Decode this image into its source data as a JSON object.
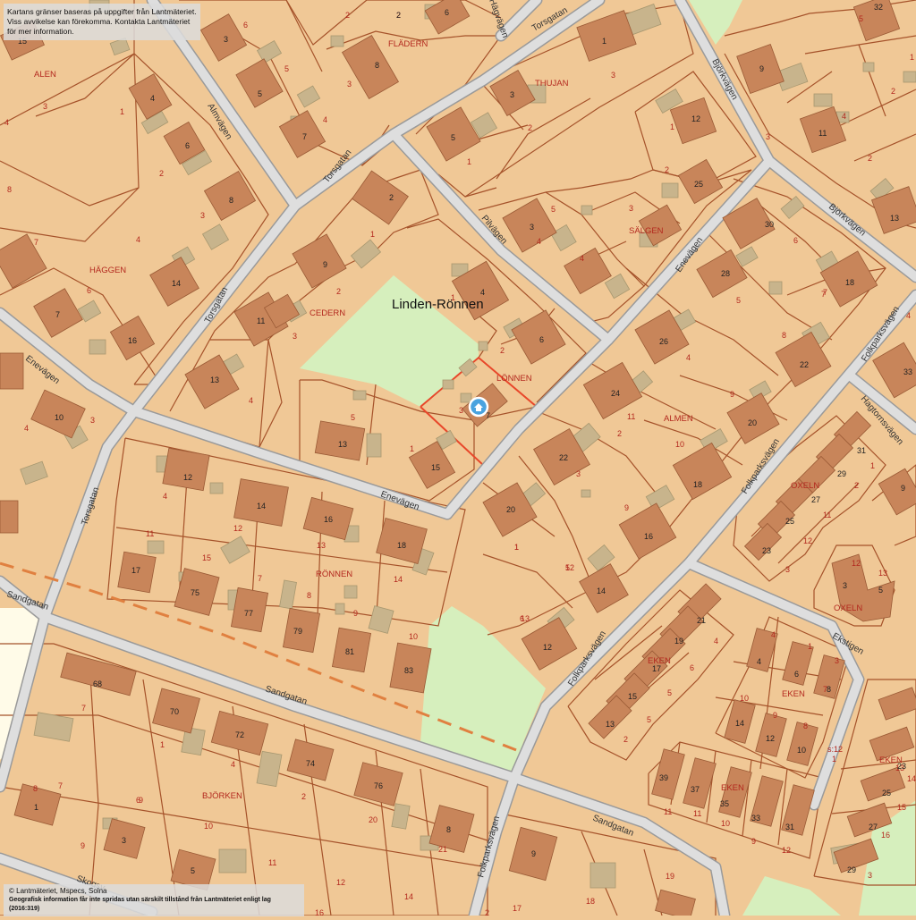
{
  "map": {
    "disclaimer_line1": "Kartans gränser baseras på uppgifter från Lantmäteriet.",
    "disclaimer_line2": "Viss avvikelse kan förekomma. Kontakta Lantmäteriet för mer information.",
    "copyright_line1": "© Lantmäteriet, Mspecs, Solna",
    "copyright_line2": "Geografisk information får inte spridas utan särskilt tillstånd från Lantmäteriet enligt lag (2016:319)",
    "area_label": "Linden-Rönnen",
    "colors": {
      "parcel": "#f0c896",
      "parcel_border": "#a5522a",
      "road": "#d9d9d9",
      "road_edge": "#a0a0a0",
      "building": "#c8855a",
      "shed": "#c8b48c",
      "park": "#d6efbd",
      "highlight": "#e8472a",
      "marker": "#4aa3df"
    },
    "marker_icon": "home-pin-icon",
    "roads": [
      {
        "label": "Torsgatan"
      },
      {
        "label": "Torsgatan"
      },
      {
        "label": "Torsgatan"
      },
      {
        "label": "Torsgatan"
      },
      {
        "label": "Hägvägen"
      },
      {
        "label": "Almvägen"
      },
      {
        "label": "Pilvägen"
      },
      {
        "label": "Björkvägen"
      },
      {
        "label": "Björkvägen"
      },
      {
        "label": "Enevägen"
      },
      {
        "label": "Enevägen"
      },
      {
        "label": "Enevägen"
      },
      {
        "label": "Folkparksvägen"
      },
      {
        "label": "Folkparksvägen"
      },
      {
        "label": "Folkparksvägen"
      },
      {
        "label": "Folkparksvägen"
      },
      {
        "label": "Sandgatan"
      },
      {
        "label": "Sandgatan"
      },
      {
        "label": "Sandgatan"
      },
      {
        "label": "Ekstigen"
      },
      {
        "label": "Hagtornsvägen"
      },
      {
        "label": "Skogsv"
      }
    ],
    "blocks": [
      {
        "label": "ALEN"
      },
      {
        "label": "FLÄDERN"
      },
      {
        "label": "THUJAN"
      },
      {
        "label": "HÄGGEN"
      },
      {
        "label": "CEDERN"
      },
      {
        "label": "SÄLGEN"
      },
      {
        "label": "LÖNNEN"
      },
      {
        "label": "ALMEN"
      },
      {
        "label": "RÖNNEN"
      },
      {
        "label": "OXELN"
      },
      {
        "label": "OXELN"
      },
      {
        "label": "EKEN"
      },
      {
        "label": "EKEN"
      },
      {
        "label": "EKEN"
      },
      {
        "label": "EKEN"
      },
      {
        "label": "BJÖRKEN"
      }
    ],
    "lot_numbers": [
      "6",
      "2",
      "1",
      "3",
      "5",
      "4",
      "2",
      "3",
      "1",
      "5",
      "4",
      "1",
      "2",
      "3",
      "4",
      "1",
      "2",
      "3",
      "4",
      "2",
      "3",
      "1",
      "2",
      "5",
      "3",
      "6",
      "7",
      "4",
      "1",
      "2",
      "5",
      "2",
      "3",
      "4",
      "3",
      "2",
      "1",
      "9",
      "4",
      "5",
      "8",
      "7",
      "10",
      "9",
      "11",
      "3",
      "1",
      "4",
      "5",
      "12",
      "13",
      "14",
      "15",
      "7",
      "8",
      "9",
      "10",
      "11",
      "6",
      "12",
      "13",
      "11",
      "12",
      "3",
      "2",
      "1",
      "4",
      "6",
      "5",
      "5",
      "2",
      "4",
      "1",
      "3",
      "7",
      "8",
      "9",
      "10",
      "11",
      "11",
      "10",
      "9",
      "12",
      "13",
      "14",
      "15",
      "16",
      "3",
      "4",
      "2",
      "1",
      "7",
      "8",
      "6",
      "9",
      "10",
      "11",
      "12",
      "14",
      "16",
      "17",
      "18",
      "19",
      "20",
      "21",
      "2",
      "6",
      "7",
      "4",
      "4",
      "3",
      "2",
      "1",
      "13",
      "12",
      "8",
      "4",
      "7",
      "9",
      "s:12",
      "1"
    ],
    "house_numbers": [
      "15",
      "3",
      "6",
      "2",
      "8",
      "32",
      "9",
      "1",
      "3",
      "5",
      "4",
      "6",
      "7",
      "12",
      "11",
      "5",
      "8",
      "25",
      "2",
      "3",
      "9",
      "13",
      "14",
      "7",
      "16",
      "11",
      "13",
      "4",
      "6",
      "30",
      "28",
      "18",
      "26",
      "22",
      "33",
      "24",
      "7",
      "10",
      "13",
      "15",
      "22",
      "20",
      "18",
      "31",
      "29",
      "27",
      "25",
      "23",
      "9",
      "12",
      "14",
      "16",
      "18",
      "17",
      "75",
      "77",
      "79",
      "81",
      "83",
      "20",
      "16",
      "14",
      "12",
      "21",
      "19",
      "17",
      "15",
      "13",
      "3",
      "5",
      "4",
      "6",
      "8",
      "14",
      "12",
      "10",
      "23",
      "25",
      "27",
      "29",
      "68",
      "70",
      "72",
      "74",
      "76",
      "8",
      "1",
      "3",
      "5",
      "9",
      "39",
      "37",
      "35",
      "33",
      "31"
    ]
  }
}
